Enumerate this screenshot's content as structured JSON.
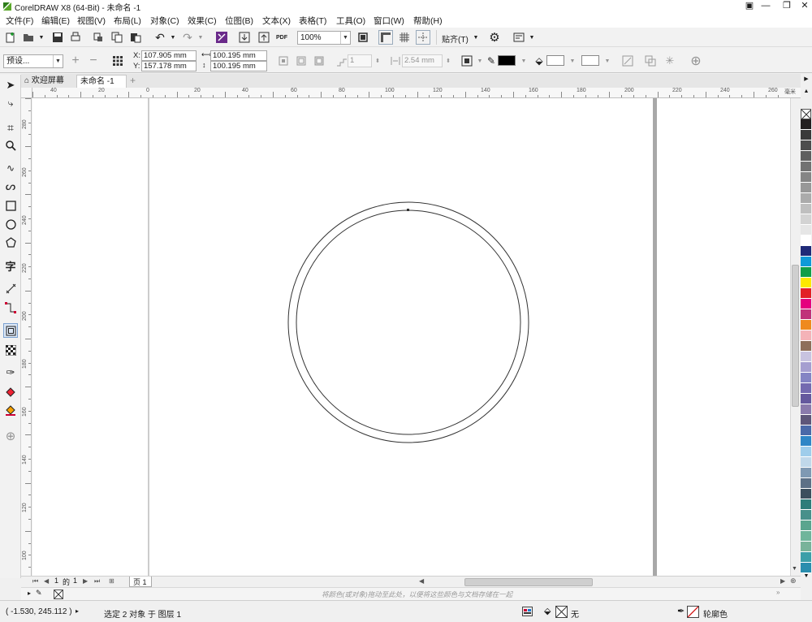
{
  "window": {
    "title": "CorelDRAW X8 (64-Bit) - 未命名 -1",
    "minimize": "—",
    "maximize": "❐",
    "close": "✕"
  },
  "menu": [
    "文件(F)",
    "编辑(E)",
    "视图(V)",
    "布局(L)",
    "对象(C)",
    "效果(C)",
    "位图(B)",
    "文本(X)",
    "表格(T)",
    "工具(O)",
    "窗口(W)",
    "帮助(H)"
  ],
  "toolbar": {
    "zoom_value": "100%",
    "snap_label": "贴齐(T)",
    "pdf_label": "PDF"
  },
  "property_bar": {
    "preset": "预设...",
    "x_label": "X:",
    "x_value": "107.905 mm",
    "y_label": "Y:",
    "y_value": "157.178 mm",
    "width_value": "100.195 mm",
    "height_value": "100.195 mm",
    "count_value": "1",
    "offset_value": "2.54 mm"
  },
  "tabs": {
    "welcome": "欢迎屏幕",
    "document": "未命名 -1",
    "add": "+"
  },
  "ruler": {
    "h_labels": [
      "40",
      "20",
      "0",
      "20",
      "40",
      "60",
      "80",
      "100",
      "120",
      "140",
      "160",
      "180",
      "200",
      "220",
      "240",
      "260"
    ],
    "h_unit": "毫米",
    "v_labels": [
      "280",
      "260",
      "240",
      "220",
      "200",
      "180",
      "160",
      "140",
      "120",
      "100",
      "80",
      "60"
    ]
  },
  "page_nav": {
    "current": "1",
    "of": "的",
    "total": "1",
    "page_tab": "页 1"
  },
  "document_palette_hint": "将颜色(或对象)拖动至此处，以便将这些颜色与文档存储在一起",
  "status": {
    "cursor_coords": "( -1.530, 245.112 )",
    "selection_info": "选定 2 对象 于 图层 1",
    "fill_label": "无",
    "outline_label": "轮廓色"
  },
  "colors": {
    "accent_selection": "#3a78c9",
    "page_shadow": "#a0a0a0"
  },
  "palette_colors": [
    "#231f20",
    "#3a3a3a",
    "#4d4d4d",
    "#5f5f5f",
    "#727272",
    "#858585",
    "#989898",
    "#ababab",
    "#bfbfbf",
    "#d3d3d3",
    "#e6e6e6",
    "#ffffff",
    "#1f2a78",
    "#0f9ad8",
    "#129e48",
    "#fde800",
    "#e21f26",
    "#e5007e",
    "#c0327a",
    "#ef8a1e",
    "#f4b3b8",
    "#8e6e5a",
    "#c8c3e0",
    "#a59ed0",
    "#8484c4",
    "#746ab0",
    "#65599e",
    "#8a7aac",
    "#5e5679",
    "#4a69a8",
    "#2f86c6",
    "#9fcdeb",
    "#c0d8ea",
    "#7f99b3",
    "#5d7086",
    "#3c4f5d",
    "#2e7d7a",
    "#48908b",
    "#5aa58e",
    "#6fb59b",
    "#79b39a",
    "#3c9fa8",
    "#2a8eae"
  ]
}
